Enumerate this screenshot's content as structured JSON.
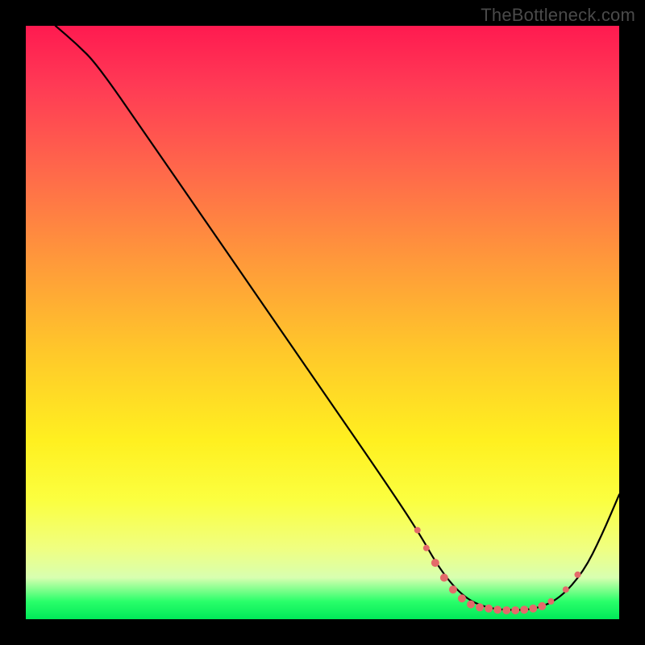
{
  "watermark": "TheBottleneck.com",
  "chart_data": {
    "type": "line",
    "title": "",
    "xlabel": "",
    "ylabel": "",
    "xlim": [
      0,
      100
    ],
    "ylim": [
      0,
      100
    ],
    "grid": false,
    "legend": false,
    "background_gradient": {
      "top": "#ff1a50",
      "bottom": "#00e858"
    },
    "series": [
      {
        "name": "curve",
        "color": "#000000",
        "x": [
          5.0,
          8.5,
          12.0,
          20.0,
          30.0,
          40.0,
          50.0,
          60.0,
          66.0,
          70.0,
          74.0,
          78.0,
          82.0,
          86.0,
          90.0,
          94.0,
          97.0,
          100.0
        ],
        "values": [
          100.0,
          97.0,
          93.5,
          82.0,
          67.5,
          53.0,
          38.5,
          24.0,
          15.0,
          8.0,
          3.5,
          1.8,
          1.5,
          1.7,
          3.5,
          8.0,
          14.0,
          21.0
        ]
      }
    ],
    "markers": {
      "color": "#e46a6a",
      "shape": "circle",
      "points": [
        {
          "x": 66.0,
          "y": 15.0,
          "r": 4
        },
        {
          "x": 67.5,
          "y": 12.0,
          "r": 4
        },
        {
          "x": 69.0,
          "y": 9.5,
          "r": 5
        },
        {
          "x": 70.5,
          "y": 7.0,
          "r": 5
        },
        {
          "x": 72.0,
          "y": 5.0,
          "r": 5
        },
        {
          "x": 73.5,
          "y": 3.5,
          "r": 5
        },
        {
          "x": 75.0,
          "y": 2.5,
          "r": 5
        },
        {
          "x": 76.5,
          "y": 2.0,
          "r": 5
        },
        {
          "x": 78.0,
          "y": 1.8,
          "r": 5
        },
        {
          "x": 79.5,
          "y": 1.6,
          "r": 5
        },
        {
          "x": 81.0,
          "y": 1.5,
          "r": 5
        },
        {
          "x": 82.5,
          "y": 1.5,
          "r": 5
        },
        {
          "x": 84.0,
          "y": 1.6,
          "r": 5
        },
        {
          "x": 85.5,
          "y": 1.8,
          "r": 5
        },
        {
          "x": 87.0,
          "y": 2.2,
          "r": 5
        },
        {
          "x": 88.5,
          "y": 3.0,
          "r": 4
        },
        {
          "x": 91.0,
          "y": 5.0,
          "r": 4
        },
        {
          "x": 93.0,
          "y": 7.5,
          "r": 4
        }
      ]
    }
  }
}
